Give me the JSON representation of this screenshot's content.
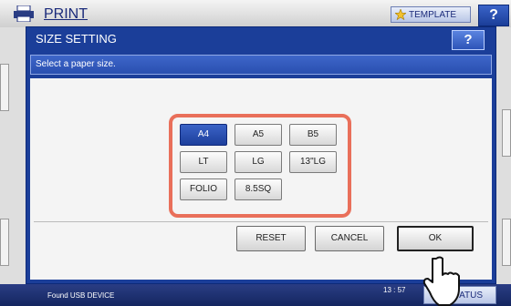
{
  "background": {
    "title": "PRINT",
    "template_label": "TEMPLATE",
    "help_label": "?",
    "footer_message": "Found USB DEVICE",
    "footer_time": "13 : 57",
    "status_label": "ATUS"
  },
  "dialog": {
    "title": "SIZE SETTING",
    "help_label": "?",
    "message": "Select a paper size.",
    "sizes": [
      "A4",
      "A5",
      "B5",
      "LT",
      "LG",
      "13\"LG",
      "FOLIO",
      "8.5SQ"
    ],
    "selected_size": "A4",
    "actions": {
      "reset": "RESET",
      "cancel": "CANCEL",
      "ok": "OK"
    }
  },
  "colors": {
    "dialog_blue": "#1b3e99",
    "selected_blue": "#1d3f9c",
    "highlight": "#e96f5a"
  }
}
